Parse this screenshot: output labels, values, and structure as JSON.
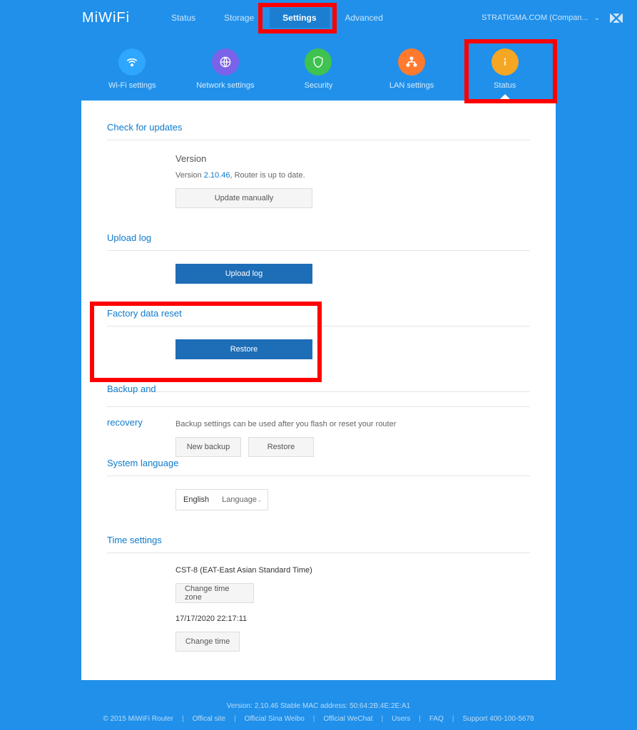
{
  "logo": "MiWiFi",
  "nav": {
    "items": [
      "Status",
      "Storage",
      "Settings",
      "Advanced"
    ],
    "active": "Settings"
  },
  "account": {
    "label": "STRATIGMA.COM (Compan..."
  },
  "subnav": {
    "tabs": [
      {
        "label": "Wi-Fi settings",
        "color": "#2fa6ff"
      },
      {
        "label": "Network settings",
        "color": "#7a63e8"
      },
      {
        "label": "Security",
        "color": "#3fc24f"
      },
      {
        "label": "LAN settings",
        "color": "#ff7a2e"
      },
      {
        "label": "Status",
        "color": "#f5a623"
      }
    ],
    "active": "Status"
  },
  "sections": {
    "updates": {
      "title": "Check for updates",
      "subheading": "Version",
      "version_prefix": "Version ",
      "version_number": "2.10.46",
      "version_suffix": ", Router is up to date.",
      "update_btn": "Update manually"
    },
    "upload_log": {
      "title": "Upload log",
      "btn": "Upload log"
    },
    "factory_reset": {
      "title": "Factory data reset",
      "btn": "Restore"
    },
    "backup": {
      "title_line1": "Backup and",
      "title_line2": "recovery",
      "desc": "Backup settings can be used after you flash or reset your router",
      "new_backup_btn": "New backup",
      "restore_btn": "Restore"
    },
    "language": {
      "title": "System language",
      "value": "English",
      "label": "Language"
    },
    "time": {
      "title": "Time settings",
      "tz": "CST-8 (EAT-East Asian Standard Time)",
      "tz_btn": "Change time zone",
      "now": "17/17/2020 22:17:11",
      "now_btn": "Change time"
    }
  },
  "footer": {
    "line1": "Version: 2.10.46 Stable  MAC address: 50:64:2B:4E:2E:A1",
    "copyright": "© 2015 MiWiFi Router",
    "links": [
      "Offical site",
      "Official Sina Weibo",
      "Official WeChat",
      "Users",
      "FAQ",
      "Support 400-100-5678"
    ]
  }
}
